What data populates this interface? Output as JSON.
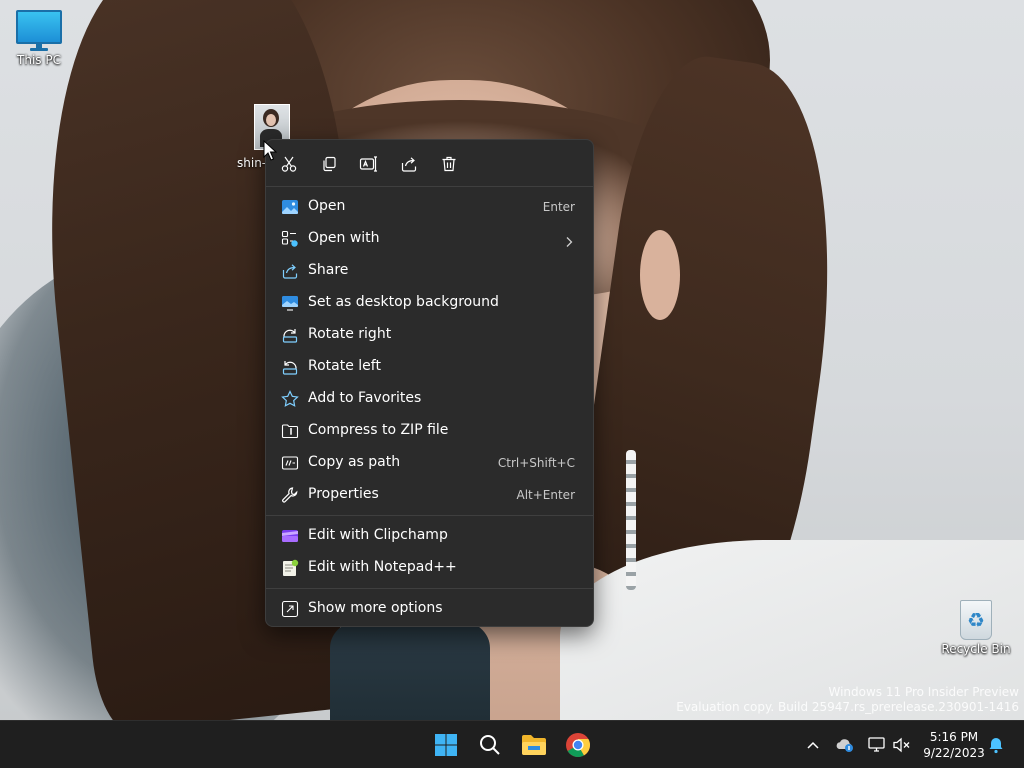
{
  "desktop": {
    "icons": [
      {
        "label": "This PC"
      },
      {
        "label": "Recycle Bin"
      }
    ],
    "selected_file_label": "shin-"
  },
  "context_menu": {
    "quick_actions": [
      {
        "name": "cut",
        "icon": "scissors-icon"
      },
      {
        "name": "copy",
        "icon": "copy-icon"
      },
      {
        "name": "rename",
        "icon": "rename-icon"
      },
      {
        "name": "share",
        "icon": "share-icon"
      },
      {
        "name": "delete",
        "icon": "trash-icon"
      }
    ],
    "items": [
      {
        "label": "Open",
        "shortcut": "Enter",
        "icon": "photos-app-icon"
      },
      {
        "label": "Open with",
        "shortcut": "",
        "icon": "open-with-icon",
        "submenu": true
      },
      {
        "label": "Share",
        "shortcut": "",
        "icon": "share-icon"
      },
      {
        "label": "Set as desktop background",
        "shortcut": "",
        "icon": "desktop-background-icon"
      },
      {
        "label": "Rotate right",
        "shortcut": "",
        "icon": "rotate-right-icon"
      },
      {
        "label": "Rotate left",
        "shortcut": "",
        "icon": "rotate-left-icon"
      },
      {
        "label": "Add to Favorites",
        "shortcut": "",
        "icon": "star-icon"
      },
      {
        "label": "Compress to ZIP file",
        "shortcut": "",
        "icon": "zip-folder-icon"
      },
      {
        "label": "Copy as path",
        "shortcut": "Ctrl+Shift+C",
        "icon": "copy-path-icon"
      },
      {
        "label": "Properties",
        "shortcut": "Alt+Enter",
        "icon": "wrench-icon"
      },
      {
        "label": "Edit with Clipchamp",
        "shortcut": "",
        "icon": "clipchamp-icon"
      },
      {
        "label": "Edit with Notepad++",
        "shortcut": "",
        "icon": "notepad-plus-plus-icon"
      },
      {
        "label": "Show more options",
        "shortcut": "",
        "icon": "more-options-icon"
      }
    ]
  },
  "watermark": {
    "line1": "Windows 11 Pro Insider Preview",
    "line2": "Evaluation copy. Build 25947.rs_prerelease.230901-1416"
  },
  "taskbar": {
    "apps": [
      "start-icon",
      "search-icon",
      "file-explorer-icon",
      "chrome-icon"
    ],
    "tray": [
      "chevron-up-icon",
      "onedrive-icon",
      "network-icon",
      "volume-muted-icon"
    ],
    "time": "5:16 PM",
    "date": "9/22/2023",
    "notification": "bell-icon"
  },
  "colors": {
    "menu_bg": "#2b2b2b",
    "taskbar_bg": "#1f1f1f",
    "accent": "#4cc2ff"
  }
}
